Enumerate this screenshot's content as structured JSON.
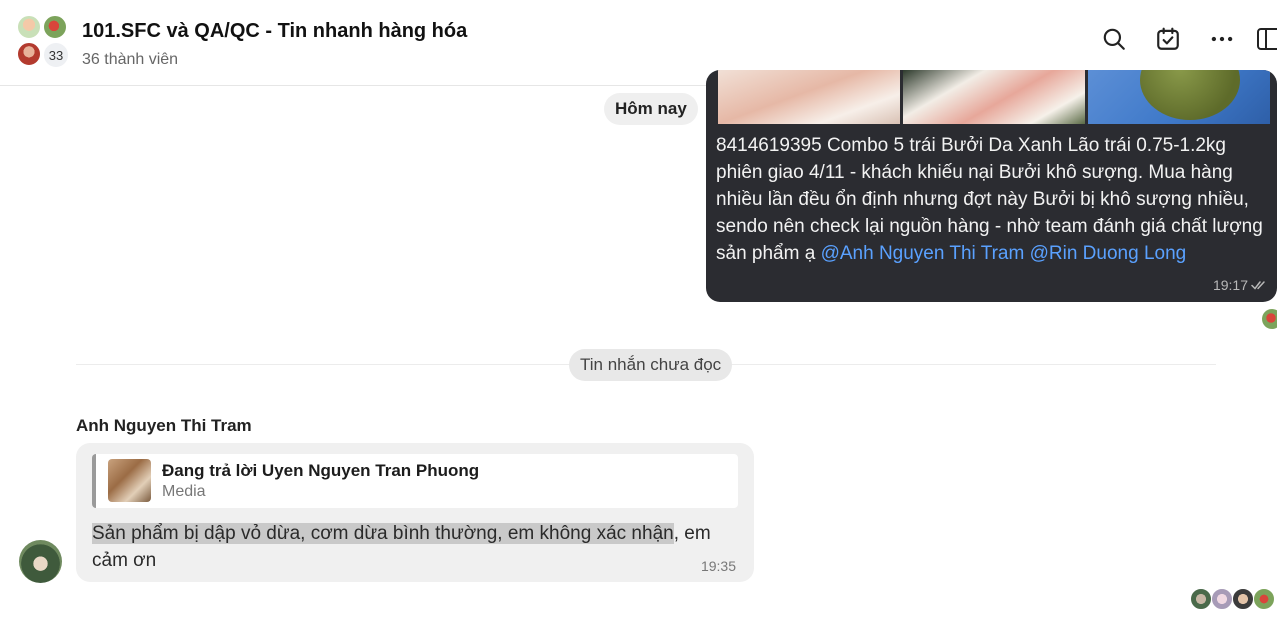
{
  "header": {
    "title": "101.SFC và QA/QC - Tin nhanh hàng hóa",
    "subtitle": "36 thành viên",
    "avatar_count": "33",
    "icons": [
      "search-icon",
      "calendar-check-icon",
      "more-icon",
      "side-panel-icon"
    ]
  },
  "chat": {
    "date_separator": "Hôm nay",
    "outgoing": {
      "text": "8414619395 Combo 5 trái Bưởi Da Xanh Lão trái 0.75-1.2kg phiên giao 4/11 - khách khiếu nại Bưởi khô sượng. Mua hàng nhiều lần đều ổn định nhưng đợt này Bưởi bị khô sượng nhiều, sendo nên check lại nguồn hàng  - nhờ team đánh giá chất lượng sản phẩm ạ ",
      "mention1": "@Anh Nguyen Thi Tram",
      "mention2": "@Rin Duong Long",
      "time": "19:17"
    },
    "unread_separator": "Tin nhắn chưa đọc",
    "incoming": {
      "sender": "Anh Nguyen Thi Tram",
      "reply_title": "Đang trả lời Uyen Nguyen Tran Phuong",
      "reply_type": "Media",
      "text_highlighted": "Sản phẩm bị dập vỏ dừa, cơm dừa bình thường, em không xác nhận",
      "text_rest": ", em cảm ơn",
      "time": "19:35"
    }
  },
  "colors": {
    "outgoing_bubble": "#2b2c31",
    "mention": "#5aa1ff",
    "incoming_bubble": "#f0f0f0",
    "highlight": "#c9c9c9"
  }
}
